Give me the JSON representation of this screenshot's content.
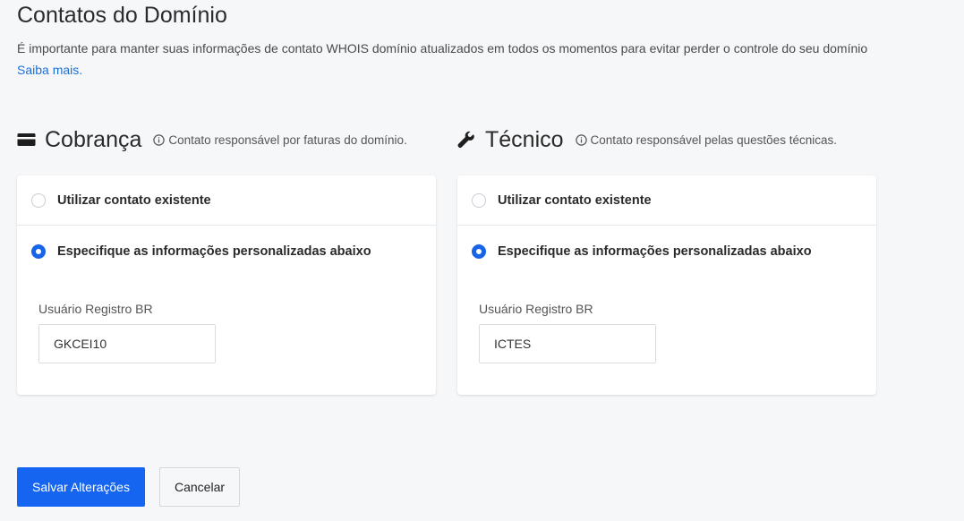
{
  "page": {
    "title": "Contatos do Domínio",
    "intro": "É importante para manter suas informações de contato WHOIS domínio atualizados em todos os momentos para evitar perder o controle do seu domínio",
    "learn_more": "Saiba mais."
  },
  "sections": [
    {
      "heading": "Cobrança",
      "icon": "credit-card-icon",
      "hint": "Contato responsável por faturas do domínio.",
      "option_existing": "Utilizar contato existente",
      "option_custom": "Especifique as informações personalizadas abaixo",
      "selected": "custom",
      "field_label": "Usuário Registro BR",
      "field_value": "GKCEI10"
    },
    {
      "heading": "Técnico",
      "icon": "wrench-icon",
      "hint": "Contato responsável pelas questões técnicas.",
      "option_existing": "Utilizar contato existente",
      "option_custom": "Especifique as informações personalizadas abaixo",
      "selected": "custom",
      "field_label": "Usuário Registro BR",
      "field_value": "ICTES"
    }
  ],
  "actions": {
    "save": "Salvar Alterações",
    "cancel": "Cancelar"
  },
  "colors": {
    "accent": "#1565f0",
    "link": "#1f6fd1",
    "background": "#f6f7f9"
  }
}
